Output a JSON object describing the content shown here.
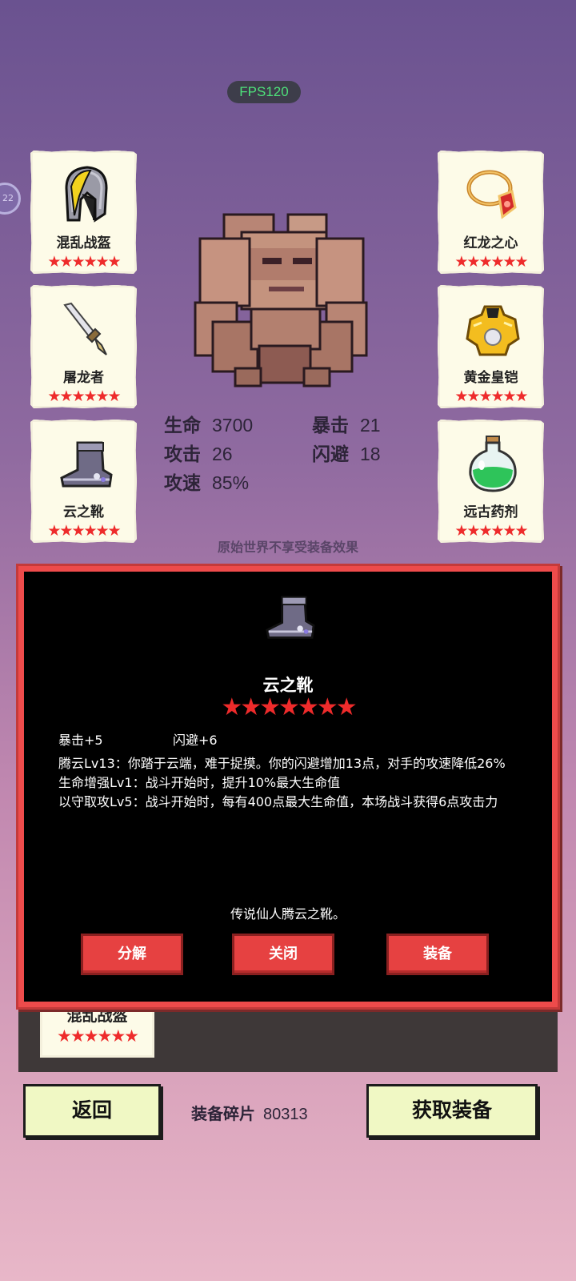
{
  "hud": {
    "fps": "FPS120",
    "side_badge": "22"
  },
  "equipment": {
    "left": [
      {
        "name": "混乱战盔",
        "stars": "★★★★★★",
        "icon": "helmet-icon"
      },
      {
        "name": "屠龙者",
        "stars": "★★★★★★",
        "icon": "dagger-icon"
      },
      {
        "name": "云之靴",
        "stars": "★★★★★★",
        "icon": "boot-icon"
      }
    ],
    "right": [
      {
        "name": "红龙之心",
        "stars": "★★★★★★",
        "icon": "amulet-icon"
      },
      {
        "name": "黄金皇铠",
        "stars": "★★★★★★",
        "icon": "golden-armor-icon"
      },
      {
        "name": "远古药剂",
        "stars": "★★★★★★",
        "icon": "potion-icon"
      }
    ]
  },
  "character": {
    "sprite": "rock-golem"
  },
  "stats": {
    "hp": {
      "label": "生命",
      "value": "3700"
    },
    "atk": {
      "label": "攻击",
      "value": "26"
    },
    "spd": {
      "label": "攻速",
      "value": "85%"
    },
    "crit": {
      "label": "暴击",
      "value": "21"
    },
    "dodge": {
      "label": "闪避",
      "value": "18"
    }
  },
  "notice": "原始世界不享受装备效果",
  "modal": {
    "title": "云之靴",
    "stars": "★★★★★★★",
    "bonus1": "暴击+5",
    "bonus2": "闪避+6",
    "desc": [
      "腾云Lv13：你踏于云端，难于捉摸。你的闪避增加13点，对手的攻速降低26%",
      "生命增强Lv1：战斗开始时，提升10%最大生命值",
      "以守取攻Lv5：战斗开始时，每有400点最大生命值，本场战斗获得6点攻击力"
    ],
    "lore": "传说仙人腾云之靴。",
    "buttons": {
      "decompose": "分解",
      "close": "关闭",
      "equip": "装备"
    }
  },
  "inventory": {
    "item": {
      "name": "混乱战盔",
      "stars": "★★★★★★"
    }
  },
  "footer": {
    "back": "返回",
    "shards_label": "装备碎片",
    "shards_value": "80313",
    "get": "获取装备"
  },
  "colors": {
    "star": "#ee2b2b",
    "modal_border": "#ee4b4b",
    "button_red": "#e64141",
    "button_light": "#f0f8c4"
  }
}
